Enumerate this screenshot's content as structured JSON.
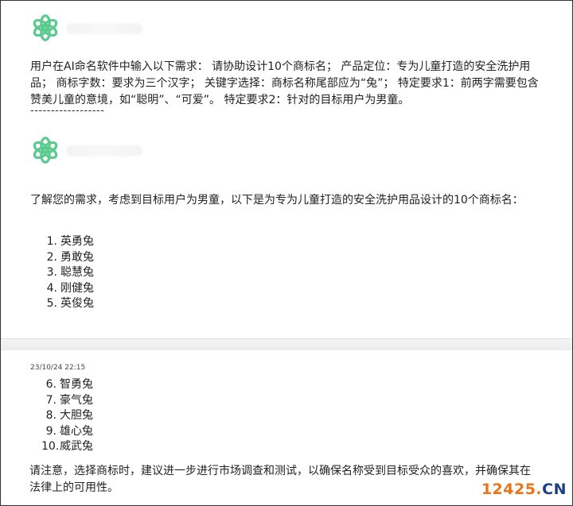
{
  "conversation": {
    "user_message": {
      "avatar_icon": "openai-logo-icon",
      "text": "用户在AI命名软件中输入以下需求： 请协助设计10个商标名； 产品定位：专为儿童打造的安全洗护用品； 商标字数：要求为三个汉字； 关键字选择：商标名称尾部应为“兔”； 特定要求1：前两字需要包含赞美儿童的意境，如“聪明”、“可爱”。 特定要求2：针对的目标用户为男童。",
      "divider": "------------------"
    },
    "assistant_message": {
      "avatar_icon": "openai-logo-icon",
      "intro": "了解您的需求，考虑到目标用户为男童，以下是为专为儿童打造的安全洗护用品设计的10个商标名：",
      "names_part1": [
        {
          "num": "1.",
          "name": "英勇兔"
        },
        {
          "num": "2.",
          "name": "勇敢兔"
        },
        {
          "num": "3.",
          "name": "聪慧兔"
        },
        {
          "num": "4.",
          "name": "刚健兔"
        },
        {
          "num": "5.",
          "name": "英俊兔"
        }
      ],
      "timestamp": "23/10/24 22:15",
      "names_part2": [
        {
          "num": "6.",
          "name": "智勇兔"
        },
        {
          "num": "7.",
          "name": "豪气兔"
        },
        {
          "num": "8.",
          "name": "大胆兔"
        },
        {
          "num": "9.",
          "name": "雄心兔"
        },
        {
          "num": "10.",
          "name": "威武兔"
        }
      ],
      "note": "请注意，选择商标时，建议进一步进行市场调查和测试，以确保名称受到目标受众的喜欢，并确保其在法律上的可用性。"
    }
  },
  "watermark": {
    "num": "12425",
    "dot": ".",
    "cn": "CN"
  },
  "colors": {
    "logo": "#5cc98f",
    "watermark_orange": "#e8741c",
    "watermark_blue": "#1a3f86"
  }
}
